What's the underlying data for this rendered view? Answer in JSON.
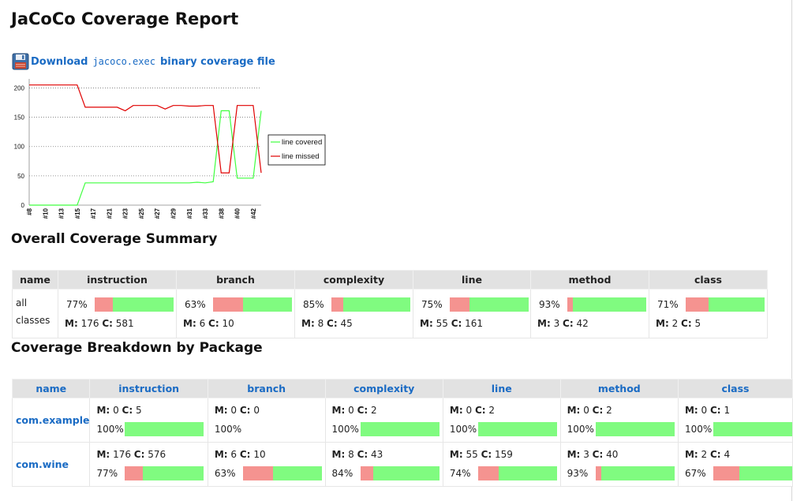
{
  "page": {
    "title": "JaCoCo Coverage Report",
    "download": {
      "prefix": "Download",
      "file": "jacoco.exec",
      "suffix": "binary coverage file"
    }
  },
  "icons": {
    "download": "floppy-disk-icon"
  },
  "colors": {
    "missed": "#f59390",
    "covered": "#80fb80",
    "link": "#1a6bc4",
    "header_bg": "#e2e2e2"
  },
  "chart_data": {
    "type": "line",
    "title": "",
    "x": [
      "#8",
      "#9",
      "#10",
      "#11",
      "#13",
      "#14",
      "#15",
      "#16",
      "#17",
      "#18",
      "#21",
      "#22",
      "#23",
      "#24",
      "#25",
      "#26",
      "#27",
      "#28",
      "#29",
      "#30",
      "#31",
      "#32",
      "#33",
      "#37",
      "#38",
      "#39",
      "#40",
      "#41",
      "#42",
      "#43"
    ],
    "x_tick_labels": [
      "#8",
      "#10",
      "#13",
      "#15",
      "#17",
      "#21",
      "#23",
      "#25",
      "#27",
      "#29",
      "#31",
      "#33",
      "#38",
      "#40",
      "#42"
    ],
    "series": [
      {
        "name": "line covered",
        "color": "#40ff40",
        "values": [
          0,
          0,
          0,
          0,
          0,
          0,
          0,
          38,
          38,
          38,
          38,
          38,
          38,
          38,
          38,
          38,
          38,
          38,
          38,
          38,
          38,
          39,
          38,
          40,
          161,
          161,
          46,
          46,
          46,
          161
        ]
      },
      {
        "name": "line missed",
        "color": "#e00000",
        "values": [
          205,
          205,
          205,
          205,
          205,
          205,
          205,
          167,
          167,
          167,
          167,
          167,
          161,
          170,
          170,
          170,
          170,
          164,
          170,
          170,
          169,
          169,
          170,
          170,
          55,
          55,
          170,
          170,
          170,
          55
        ]
      }
    ],
    "ylim": [
      0,
      210
    ],
    "y_ticks": [
      0,
      50,
      100,
      150,
      200
    ],
    "grid": "horizontal dotted",
    "legend": "right"
  },
  "summary": {
    "title": "Overall Coverage Summary",
    "headers": [
      "name",
      "instruction",
      "branch",
      "complexity",
      "line",
      "method",
      "class"
    ],
    "row": {
      "name": "all classes",
      "cells": [
        {
          "pct": "77%",
          "missed": 176,
          "covered": 581,
          "m": "M: 176",
          "c": "C: 581"
        },
        {
          "pct": "63%",
          "missed": 6,
          "covered": 10,
          "m": "M: 6",
          "c": "C: 10"
        },
        {
          "pct": "85%",
          "missed": 8,
          "covered": 45,
          "m": "M: 8",
          "c": "C: 45"
        },
        {
          "pct": "75%",
          "missed": 55,
          "covered": 161,
          "m": "M: 55",
          "c": "C: 161"
        },
        {
          "pct": "93%",
          "missed": 3,
          "covered": 42,
          "m": "M: 3",
          "c": "C: 42"
        },
        {
          "pct": "71%",
          "missed": 2,
          "covered": 5,
          "m": "M: 2",
          "c": "C: 5"
        }
      ]
    }
  },
  "packages": {
    "title": "Coverage Breakdown by Package",
    "headers": [
      "name",
      "instruction",
      "branch",
      "complexity",
      "line",
      "method",
      "class"
    ],
    "rows": [
      {
        "name": "com.example",
        "cells": [
          {
            "pct": "100%",
            "missed": 0,
            "covered": 5,
            "m": "M: 0",
            "c": "C: 5"
          },
          {
            "pct": "100%",
            "missed": 0,
            "covered": 0,
            "m": "M: 0",
            "c": "C: 0"
          },
          {
            "pct": "100%",
            "missed": 0,
            "covered": 2,
            "m": "M: 0",
            "c": "C: 2"
          },
          {
            "pct": "100%",
            "missed": 0,
            "covered": 2,
            "m": "M: 0",
            "c": "C: 2"
          },
          {
            "pct": "100%",
            "missed": 0,
            "covered": 2,
            "m": "M: 0",
            "c": "C: 2"
          },
          {
            "pct": "100%",
            "missed": 0,
            "covered": 1,
            "m": "M: 0",
            "c": "C: 1"
          }
        ]
      },
      {
        "name": "com.wine",
        "cells": [
          {
            "pct": "77%",
            "missed": 176,
            "covered": 576,
            "m": "M: 176",
            "c": "C: 576"
          },
          {
            "pct": "63%",
            "missed": 6,
            "covered": 10,
            "m": "M: 6",
            "c": "C: 10"
          },
          {
            "pct": "84%",
            "missed": 8,
            "covered": 43,
            "m": "M: 8",
            "c": "C: 43"
          },
          {
            "pct": "74%",
            "missed": 55,
            "covered": 159,
            "m": "M: 55",
            "c": "C: 159"
          },
          {
            "pct": "93%",
            "missed": 3,
            "covered": 40,
            "m": "M: 3",
            "c": "C: 40"
          },
          {
            "pct": "67%",
            "missed": 2,
            "covered": 4,
            "m": "M: 2",
            "c": "C: 4"
          }
        ]
      }
    ]
  }
}
